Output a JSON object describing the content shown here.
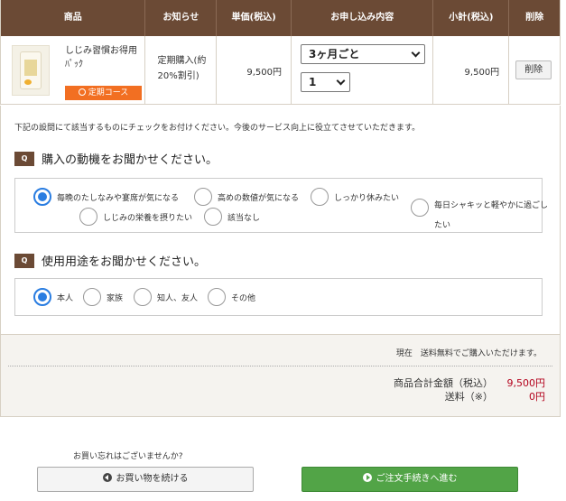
{
  "table": {
    "headers": [
      "商品",
      "お知らせ",
      "単価(税込)",
      "お申し込み内容",
      "小計(税込)",
      "削除"
    ],
    "row": {
      "product_name": "しじみ習慣お得用ﾊﾟｯｸ",
      "course_label": "定期コース",
      "notice": "定期購入(約20%割引)",
      "unit_price": "9,500円",
      "interval_select": "3ヶ月ごと",
      "quantity_select": "1",
      "subtotal": "9,500円",
      "delete_label": "削除"
    }
  },
  "survey": {
    "intro": "下記の設問にて該当するものにチェックをお付けください。今後のサービス向上に役立てさせていただきます。",
    "q1": {
      "badge": "Q",
      "title": "購入の動機をお聞かせください。",
      "options": [
        {
          "label": "毎晩のたしなみや宴席が気になる",
          "checked": true
        },
        {
          "label": "高めの数値が気になる",
          "checked": false
        },
        {
          "label": "しっかり休みたい",
          "checked": false
        },
        {
          "label": "毎日シャキッと軽やかに過ごしたい",
          "checked": false
        },
        {
          "label": "しじみの栄養を摂りたい",
          "checked": false
        },
        {
          "label": "該当なし",
          "checked": false
        }
      ]
    },
    "q2": {
      "badge": "Q",
      "title": "使用用途をお聞かせください。",
      "options": [
        {
          "label": "本人",
          "checked": true
        },
        {
          "label": "家族",
          "checked": false
        },
        {
          "label": "知人、友人",
          "checked": false
        },
        {
          "label": "その他",
          "checked": false
        }
      ]
    }
  },
  "totals": {
    "shipping_note": "現在　送料無料でご購入いただけます。",
    "subtotal_label": "商品合計金額（税込）",
    "subtotal_value": "9,500円",
    "shipping_label": "送料（※）",
    "shipping_value": "0円"
  },
  "footer": {
    "forgot_text": "お買い忘れはございませんか?",
    "continue_label": "お買い物を続ける",
    "checkout_label": "ご注文手続きへ進む"
  },
  "colors": {
    "header_bg": "#6b4a35",
    "course_orange": "#f26f22",
    "price_red": "#b3001b",
    "checkout_green": "#52a447",
    "radio_blue": "#2a7de1"
  }
}
